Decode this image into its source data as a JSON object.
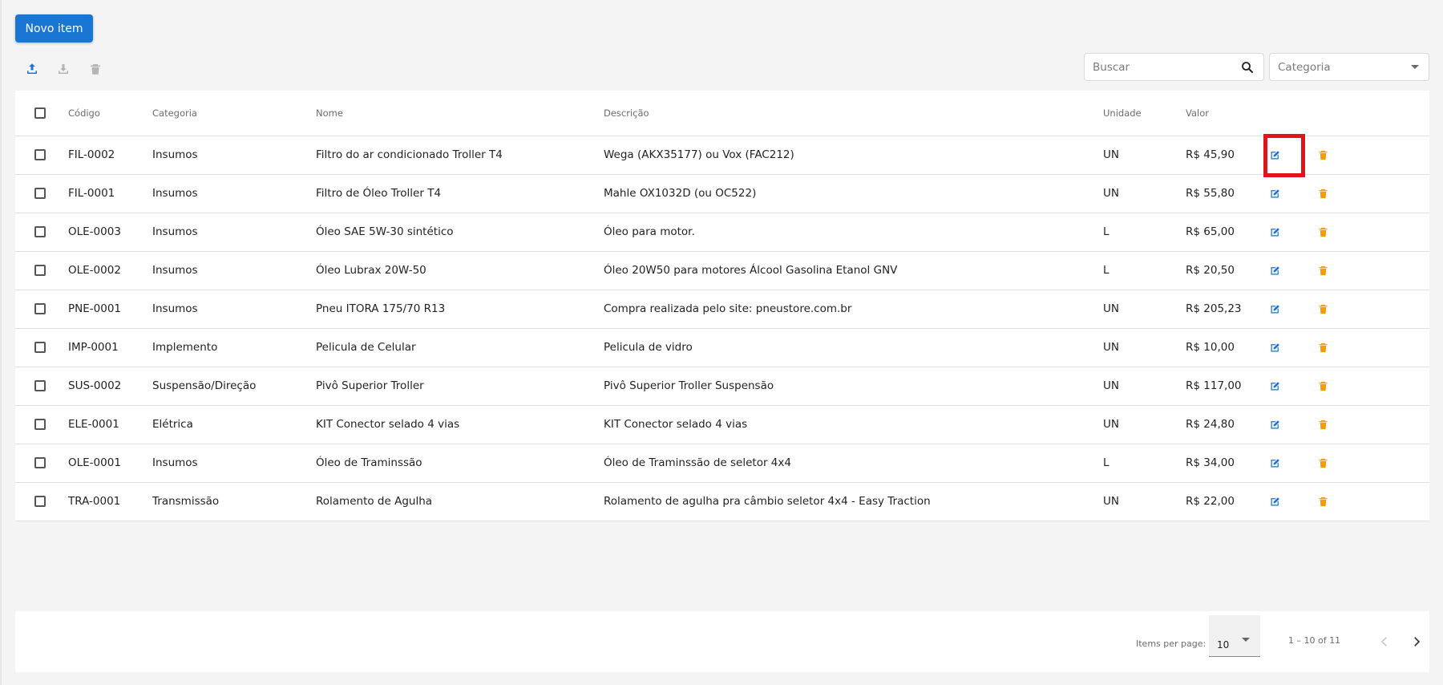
{
  "toolbar": {
    "new_item_label": "Novo item",
    "upload_icon": "upload-icon",
    "download_icon": "download-icon",
    "delete_icon": "trash-icon"
  },
  "filters": {
    "search_placeholder": "Buscar",
    "category_placeholder": "Categoria"
  },
  "colors": {
    "primary": "#1976d2",
    "edit_icon": "#1976d2",
    "delete_icon": "#f39c12",
    "highlight": "#e0141e"
  },
  "table": {
    "headers": {
      "code": "Código",
      "category": "Categoria",
      "name": "Nome",
      "description": "Descrição",
      "unit": "Unidade",
      "value": "Valor"
    },
    "rows": [
      {
        "code": "FIL-0002",
        "category": "Insumos",
        "name": "Filtro do ar condicionado Troller T4",
        "description": "Wega (AKX35177) ou Vox (FAC212)",
        "unit": "UN",
        "value": "R$ 45,90"
      },
      {
        "code": "FIL-0001",
        "category": "Insumos",
        "name": "Filtro de Óleo Troller T4",
        "description": "Mahle OX1032D (ou OC522)",
        "unit": "UN",
        "value": "R$ 55,80"
      },
      {
        "code": "OLE-0003",
        "category": "Insumos",
        "name": "Óleo SAE 5W-30 sintético",
        "description": "Óleo para motor.",
        "unit": "L",
        "value": "R$ 65,00"
      },
      {
        "code": "OLE-0002",
        "category": "Insumos",
        "name": "Óleo Lubrax 20W-50",
        "description": "Óleo 20W50 para motores Álcool Gasolina Etanol GNV",
        "unit": "L",
        "value": "R$ 20,50"
      },
      {
        "code": "PNE-0001",
        "category": "Insumos",
        "name": "Pneu ITORA 175/70 R13",
        "description": "Compra realizada pelo site: pneustore.com.br",
        "unit": "UN",
        "value": "R$ 205,23"
      },
      {
        "code": "IMP-0001",
        "category": "Implemento",
        "name": "Pelicula de Celular",
        "description": "Pelicula de vidro",
        "unit": "UN",
        "value": "R$ 10,00"
      },
      {
        "code": "SUS-0002",
        "category": "Suspensão/Direção",
        "name": "Pivô Superior Troller",
        "description": "Pivô Superior Troller Suspensão",
        "unit": "UN",
        "value": "R$ 117,00"
      },
      {
        "code": "ELE-0001",
        "category": "Elétrica",
        "name": "KIT Conector selado 4 vias",
        "description": "KIT Conector selado 4 vias",
        "unit": "UN",
        "value": "R$ 24,80"
      },
      {
        "code": "OLE-0001",
        "category": "Insumos",
        "name": "Óleo de Traminssão",
        "description": "Óleo de Traminssão de seletor 4x4",
        "unit": "L",
        "value": "R$ 34,00"
      },
      {
        "code": "TRA-0001",
        "category": "Transmissão",
        "name": "Rolamento de Agulha",
        "description": "Rolamento de agulha pra câmbio seletor 4x4 - Easy Traction",
        "unit": "UN",
        "value": "R$ 22,00"
      }
    ]
  },
  "paginator": {
    "items_per_page_label": "Items per page:",
    "page_size": "10",
    "range_label": "1 – 10 of 11"
  }
}
